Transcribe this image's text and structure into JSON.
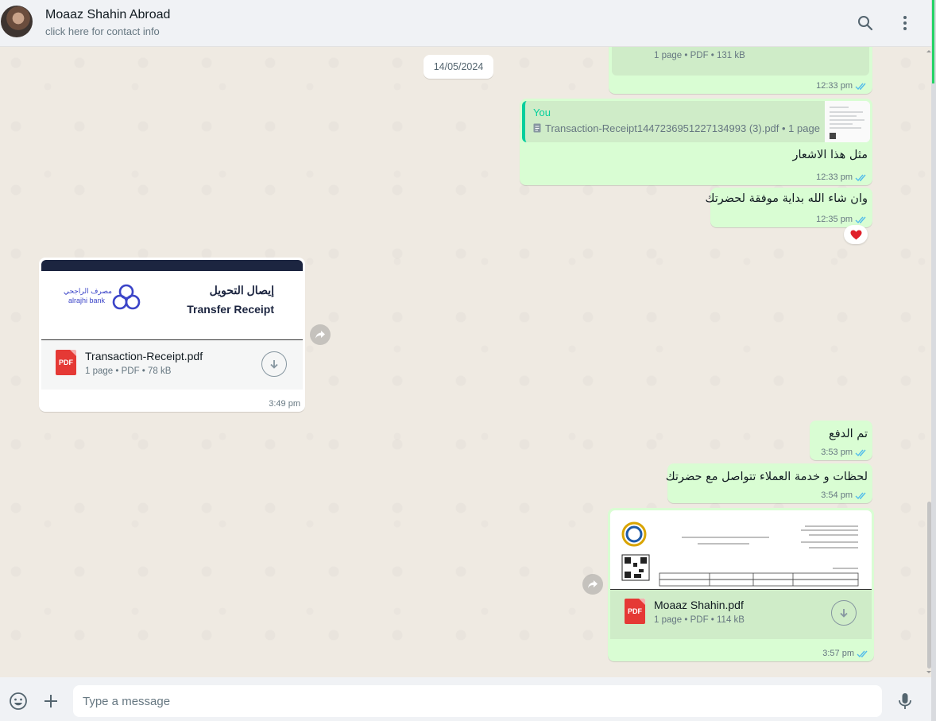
{
  "header": {
    "contact_name": "Moaaz Shahin Abroad",
    "contact_sub": "click here for contact info",
    "icons": [
      "search-icon",
      "menu-icon"
    ]
  },
  "date_chip": "14/05/2024",
  "messages": {
    "m1": {
      "meta": "1 page • PDF • 131 kB",
      "time": "12:33 pm"
    },
    "m2": {
      "quote_author": "You",
      "quote_file": "Transaction-Receipt1447236951227134993 (3).pdf • 1 page",
      "text": "مثل هذا الاشعار",
      "time": "12:33 pm"
    },
    "m3": {
      "text": "وان شاء الله بداية موفقة لحضرتك",
      "time": "12:35 pm",
      "reaction": "❤️"
    },
    "m4": {
      "receipt_ar": "إيصال التحويل",
      "receipt_en": "Transfer Receipt",
      "bank_ar": "مصرف الراجحي",
      "bank_en": "alrajhi bank",
      "file_name": "Transaction-Receipt.pdf",
      "meta": "1 page • PDF • 78 kB",
      "time": "3:49 pm"
    },
    "m5": {
      "text": "تم الدفع",
      "time": "3:53 pm"
    },
    "m6": {
      "text": "لحظات و خدمة العملاء تتواصل مع حضرتك",
      "time": "3:54 pm"
    },
    "m7": {
      "file_name": "Moaaz Shahin.pdf",
      "meta": "1 page • PDF • 114 kB",
      "time": "3:57 pm"
    }
  },
  "pdf_label": "PDF",
  "composer": {
    "placeholder": "Type a message"
  },
  "colors": {
    "outgoing": "#d9fdd3",
    "incoming": "#ffffff",
    "tick_read": "#53bdeb",
    "accent": "#25d366"
  }
}
